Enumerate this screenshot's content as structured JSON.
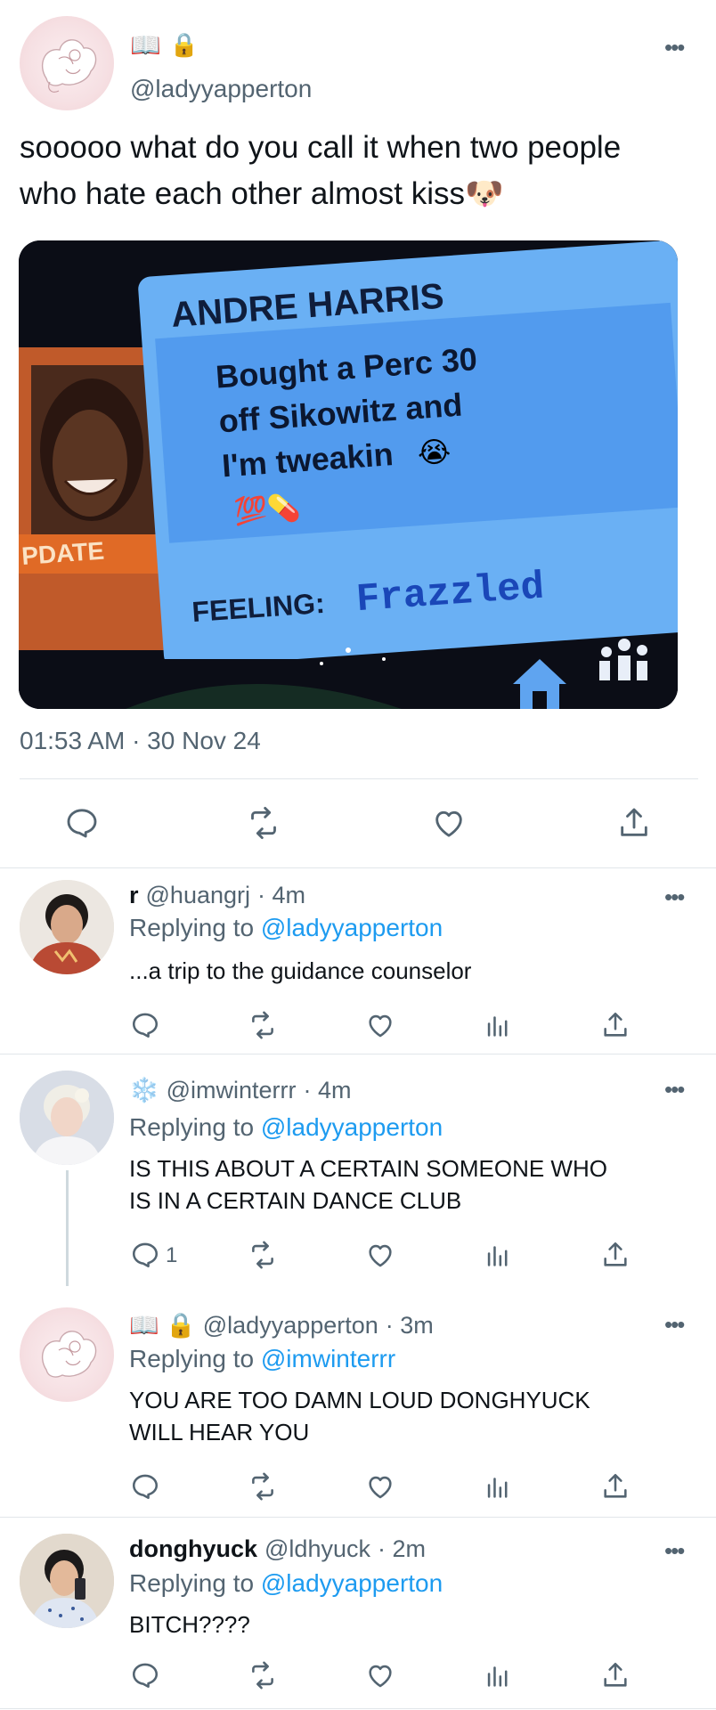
{
  "main_tweet": {
    "badges": [
      "📖",
      "🔒"
    ],
    "handle": "@ladyyapperton",
    "text_line1": "sooooo what do you call it when two people",
    "text_line2": "who hate each other almost kiss",
    "text_emoji": "🐶",
    "image": {
      "name_text": "Andre Harris",
      "status_line1": "Bought a Perc 30",
      "status_line2": "off Sikowitz and",
      "status_line3": "I'm tweakin",
      "status_emoji": "😭",
      "status_emoji2": "💯💊",
      "feeling_label": "Feeling:",
      "feeling_value": "Frazzled",
      "update_label": "PDATE"
    },
    "timestamp": "01:53 AM · 30 Nov 24"
  },
  "replies": [
    {
      "display_name": "r",
      "handle": "@huangrj",
      "time": "· 4m",
      "replying_prefix": "Replying to",
      "replying_to": "@ladyyapperton",
      "body_line1": "...a trip to the guidance counselor",
      "body_line2": "",
      "reply_count": ""
    },
    {
      "display_name": "❄️",
      "handle": "@imwinterrr",
      "time": "· 4m",
      "replying_prefix": "Replying to",
      "replying_to": "@ladyyapperton",
      "body_line1": "IS THIS ABOUT A CERTAIN SOMEONE WHO",
      "body_line2": "IS IN A CERTAIN DANCE CLUB",
      "reply_count": "1"
    },
    {
      "display_name": "📖 🔒",
      "handle": "@ladyyapperton",
      "time": "· 3m",
      "replying_prefix": "Replying to",
      "replying_to": "@imwinterrr",
      "body_line1": "YOU ARE TOO DAMN LOUD DONGHYUCK",
      "body_line2": "WILL HEAR YOU",
      "reply_count": ""
    },
    {
      "display_name": "donghyuck",
      "handle": "@ldhyuck",
      "time": "· 2m",
      "replying_prefix": "Replying to",
      "replying_to": "@ladyyapperton",
      "body_line1": "BITCH????",
      "body_line2": "",
      "reply_count": ""
    }
  ],
  "more_glyph": "•••",
  "icons": [
    "reply-icon",
    "retweet-icon",
    "like-icon",
    "views-icon",
    "share-icon"
  ],
  "colors": {
    "accent": "#1d9bf0",
    "secondary_text": "#536471",
    "divider": "#e1e6ea"
  }
}
